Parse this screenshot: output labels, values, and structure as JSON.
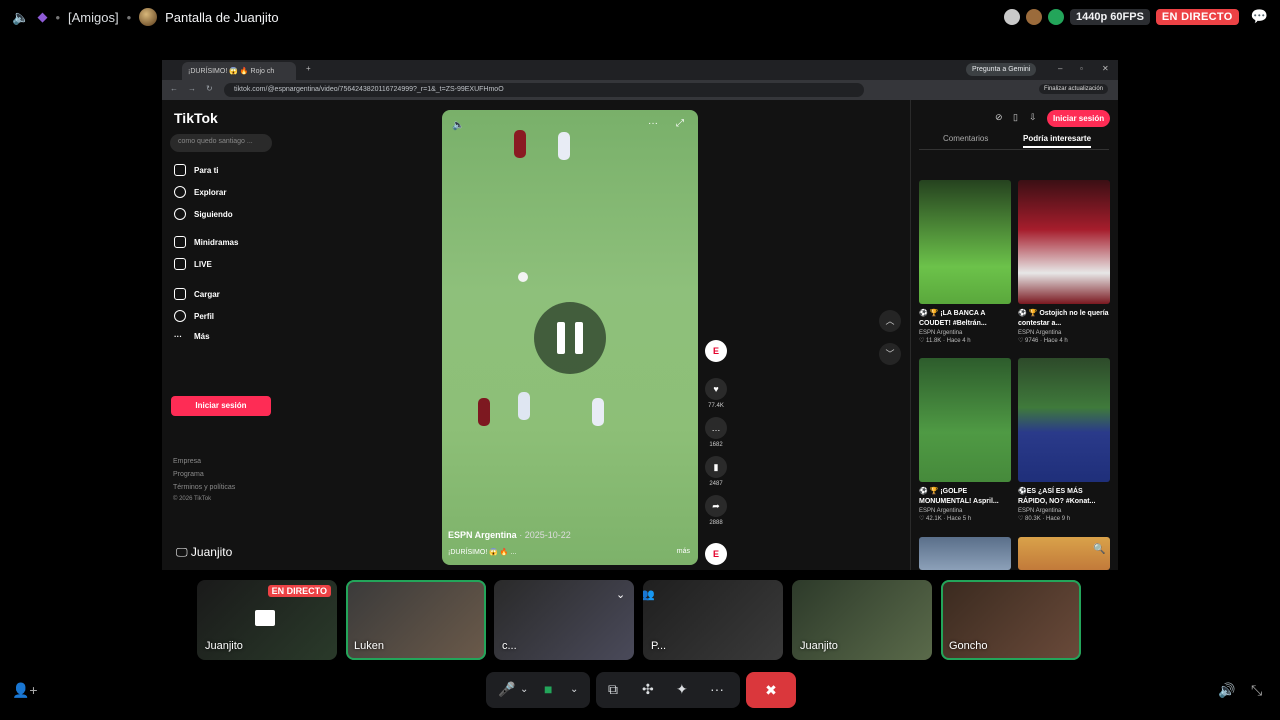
{
  "topbar": {
    "channel": "[Amigos]",
    "stream_title": "Pantalla de Juanjito",
    "quality": "1440p 60FPS",
    "live": "EN DIRECTO"
  },
  "browser": {
    "tab_title": "¡DURÍSIMO! 😱 🔥 Rojo ch",
    "gemini": "Pregunta a Gemini",
    "url": "tiktok.com/@espnargentina/video/7564243820116724999?_r=1&_t=ZS-99EXUFHmoO",
    "update": "Finalizar actualización"
  },
  "tiktok": {
    "logo": "TikTok",
    "search_placeholder": "como quedo santiago ...",
    "nav": [
      "Para ti",
      "Explorar",
      "Siguiendo",
      "Minidramas",
      "LIVE",
      "Cargar",
      "Perfil",
      "Más"
    ],
    "login": "Iniciar sesión",
    "footer": [
      "Empresa",
      "Programa",
      "Términos y políticas",
      "© 2026 TikTok"
    ],
    "video": {
      "author": "ESPN Argentina",
      "date": "· 2025-10-22",
      "desc": "¡DURÍSIMO! 😱 🔥 ...",
      "more": "más"
    },
    "actions": {
      "likes": "77.4K",
      "comments": "1682",
      "saves": "2487",
      "shares": "2888"
    },
    "right": {
      "login": "Iniciar sesión",
      "tab_comments": "Comentarios",
      "tab_suggest": "Podría interesarte",
      "cards": [
        {
          "title": "⚽ 🏆 ¡LA BANCA A COUDET! #Beltrán...",
          "author": "ESPN Argentina",
          "meta": "♡ 11.8K · Hace 4 h"
        },
        {
          "title": "⚽ 🏆 Ostojich no le quería contestar a...",
          "author": "ESPN Argentina",
          "meta": "♡ 9746 · Hace 4 h"
        },
        {
          "title": "⚽ 🏆 ¡GOLPE MONUMENTAL! Aspril...",
          "author": "ESPN Argentina",
          "meta": "♡ 42.1K · Hace 5 h"
        },
        {
          "title": "⚽ES ¿ASÍ ES MÁS RÁPIDO, NO? #Konat...",
          "author": "ESPN Argentina",
          "meta": "♡ 80.3K · Hace 9 h"
        }
      ]
    }
  },
  "presenter": "Juanjito",
  "participants": [
    {
      "name": "Juanjito",
      "live": "EN DIRECTO"
    },
    {
      "name": "Luken"
    },
    {
      "name": "c..."
    },
    {
      "name": "P..."
    },
    {
      "name": "Juanjito"
    },
    {
      "name": "Goncho"
    }
  ]
}
